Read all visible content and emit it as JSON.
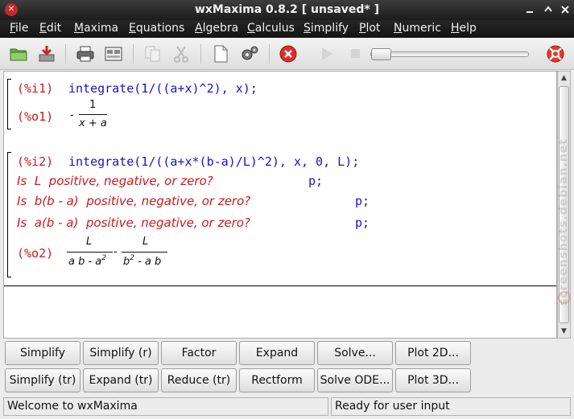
{
  "window": {
    "title": "wxMaxima 0.8.2 [ unsaved* ]"
  },
  "menu": [
    {
      "label": "File",
      "u": "F",
      "rest": "ile"
    },
    {
      "label": "Edit",
      "u": "E",
      "rest": "dit"
    },
    {
      "label": "Maxima",
      "u": "M",
      "rest": "axima"
    },
    {
      "label": "Equations",
      "u": "E",
      "rest": "quations"
    },
    {
      "label": "Algebra",
      "u": "A",
      "rest": "lgebra"
    },
    {
      "label": "Calculus",
      "u": "C",
      "rest": "alculus"
    },
    {
      "label": "Simplify",
      "u": "S",
      "rest": "implify"
    },
    {
      "label": "Plot",
      "u": "P",
      "rest": "lot"
    },
    {
      "label": "Numeric",
      "u": "N",
      "rest": "umeric"
    },
    {
      "label": "Help",
      "u": "H",
      "rest": "elp"
    }
  ],
  "toolbar": {
    "icons": [
      "open-icon",
      "save-icon",
      "print-icon",
      "configure-icon",
      "copy-icon",
      "cut-icon",
      "new-icon",
      "settings-icon",
      "interrupt-icon",
      "play-icon",
      "stop-icon",
      "help-icon"
    ]
  },
  "worksheet": {
    "cell1": {
      "input_label": "(%i1)",
      "input": "integrate(1/((a+x)^2), x);",
      "output_label": "(%o1)",
      "out_sign": "-",
      "out_num": "1",
      "out_den": "x + a"
    },
    "cell2": {
      "input_label": "(%i2)",
      "input": "integrate(1/((a+x*(b-a)/L)^2), x, 0, L);",
      "questions": [
        {
          "text": "Is  L  positive, negative, or zero?",
          "answer": "p;"
        },
        {
          "text": "Is  b(b - a)  positive, negative, or zero?",
          "answer": "p;"
        },
        {
          "text": "Is  a(b - a)  positive, negative, or zero?",
          "answer": "p;"
        }
      ],
      "output_label": "(%o2)",
      "frac1_num": "L",
      "frac1_den": "a b - a",
      "frac1_den_exp": "2",
      "minus": "-",
      "frac2_num": "L",
      "frac2_den": "b",
      "frac2_den_exp": "2",
      "frac2_den_rest": " - a b"
    }
  },
  "watermark": "screenshots.debian.net",
  "buttons": {
    "row1": [
      "Simplify",
      "Simplify (r)",
      "Factor",
      "Expand",
      "Solve...",
      "Plot 2D..."
    ],
    "row2": [
      "Simplify (tr)",
      "Expand (tr)",
      "Reduce (tr)",
      "Rectform",
      "Solve ODE...",
      "Plot 3D..."
    ]
  },
  "status": {
    "left": "Welcome to wxMaxima",
    "right": "Ready for user input"
  }
}
